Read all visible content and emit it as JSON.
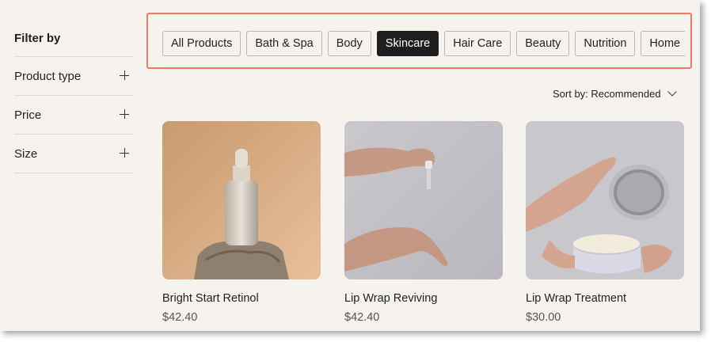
{
  "sidebar": {
    "title": "Filter by",
    "filters": [
      {
        "label": "Product type"
      },
      {
        "label": "Price"
      },
      {
        "label": "Size"
      }
    ]
  },
  "categories": {
    "items": [
      "All Products",
      "Bath & Spa",
      "Body",
      "Skincare",
      "Hair Care",
      "Beauty",
      "Nutrition",
      "Home"
    ],
    "active": "Skincare"
  },
  "sort": {
    "label": "Sort by: Recommended"
  },
  "products": [
    {
      "name": "Bright Start Retinol",
      "price": "$42.40"
    },
    {
      "name": "Lip Wrap Reviving",
      "price": "$42.40"
    },
    {
      "name": "Lip Wrap Treatment",
      "price": "$30.00"
    }
  ],
  "colors": {
    "accent_outline": "#ee7b61",
    "active_pill": "#1e1e1e",
    "page_bg": "#f6f3ee"
  }
}
